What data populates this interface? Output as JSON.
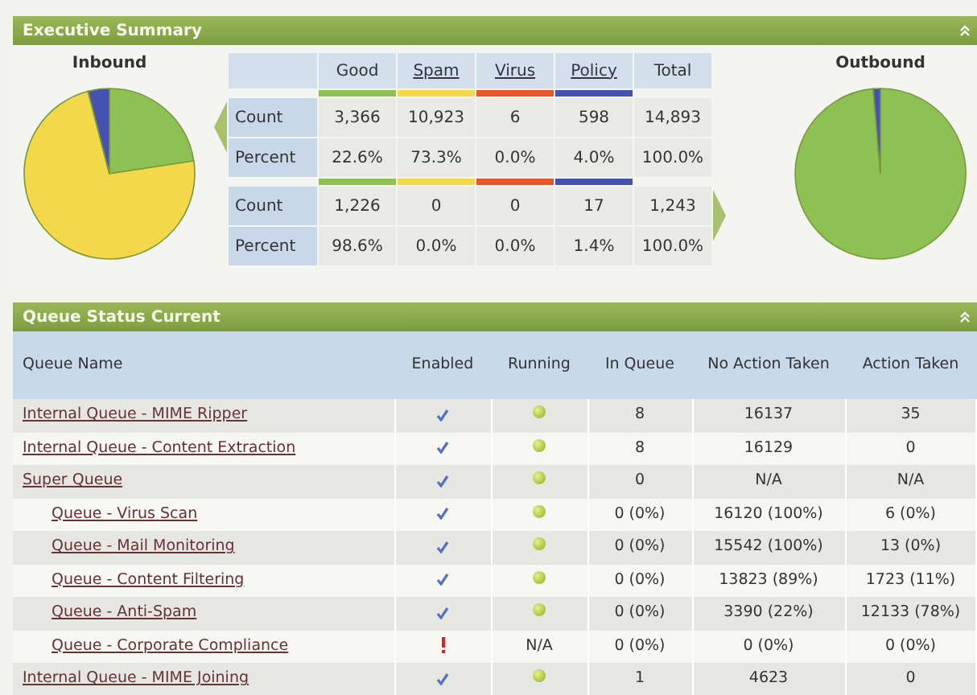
{
  "summary": {
    "title": "Executive Summary",
    "inbound_label": "Inbound",
    "outbound_label": "Outbound",
    "columns": [
      {
        "label": "Good",
        "link": false,
        "color": "#8dc153"
      },
      {
        "label": "Spam",
        "link": true,
        "color": "#f3d84a"
      },
      {
        "label": "Virus",
        "link": true,
        "color": "#e8562a"
      },
      {
        "label": "Policy",
        "link": true,
        "color": "#4652b0"
      },
      {
        "label": "Total",
        "link": false
      }
    ],
    "blocks": [
      {
        "rows": [
          {
            "label": "Count",
            "values": [
              "3,366",
              "10,923",
              "6",
              "598",
              "14,893"
            ]
          },
          {
            "label": "Percent",
            "values": [
              "22.6%",
              "73.3%",
              "0.0%",
              "4.0%",
              "100.0%"
            ]
          }
        ]
      },
      {
        "rows": [
          {
            "label": "Count",
            "values": [
              "1,226",
              "0",
              "0",
              "17",
              "1,243"
            ]
          },
          {
            "label": "Percent",
            "values": [
              "98.6%",
              "0.0%",
              "0.0%",
              "1.4%",
              "100.0%"
            ]
          }
        ]
      }
    ]
  },
  "queue": {
    "title": "Queue Status Current",
    "columns": [
      "Queue Name",
      "Enabled",
      "Running",
      "In Queue",
      "No Action Taken",
      "Action Taken"
    ],
    "rows": [
      {
        "name": "Internal Queue - MIME Ripper",
        "enabled": true,
        "running": true,
        "in_queue": "8",
        "no_action": "16137",
        "action": "35"
      },
      {
        "name": "Internal Queue - Content Extraction",
        "enabled": true,
        "running": true,
        "in_queue": "8",
        "no_action": "16129",
        "action": "0"
      },
      {
        "name": "Super Queue",
        "enabled": true,
        "running": true,
        "in_queue": "0",
        "no_action": "N/A",
        "action": "N/A",
        "children": [
          {
            "name": "Queue - Virus Scan",
            "enabled": true,
            "running": true,
            "in_queue": "0 (0%)",
            "no_action": "16120 (100%)",
            "action": "6 (0%)"
          },
          {
            "name": "Queue - Mail Monitoring",
            "enabled": true,
            "running": true,
            "in_queue": "0 (0%)",
            "no_action": "15542 (100%)",
            "action": "13 (0%)"
          },
          {
            "name": "Queue - Content Filtering",
            "enabled": true,
            "running": true,
            "in_queue": "0 (0%)",
            "no_action": "13823 (89%)",
            "action": "1723 (11%)"
          },
          {
            "name": "Queue - Anti-Spam",
            "enabled": true,
            "running": true,
            "in_queue": "0 (0%)",
            "no_action": "3390 (22%)",
            "action": "12133 (78%)"
          },
          {
            "name": "Queue - Corporate Compliance",
            "enabled": false,
            "running": false,
            "running_label": "N/A",
            "in_queue": "0 (0%)",
            "no_action": "0 (0%)",
            "action": "0 (0%)"
          }
        ]
      },
      {
        "name": "Internal Queue - MIME Joining",
        "enabled": true,
        "running": true,
        "in_queue": "1",
        "no_action": "4623",
        "action": "0"
      }
    ]
  }
}
